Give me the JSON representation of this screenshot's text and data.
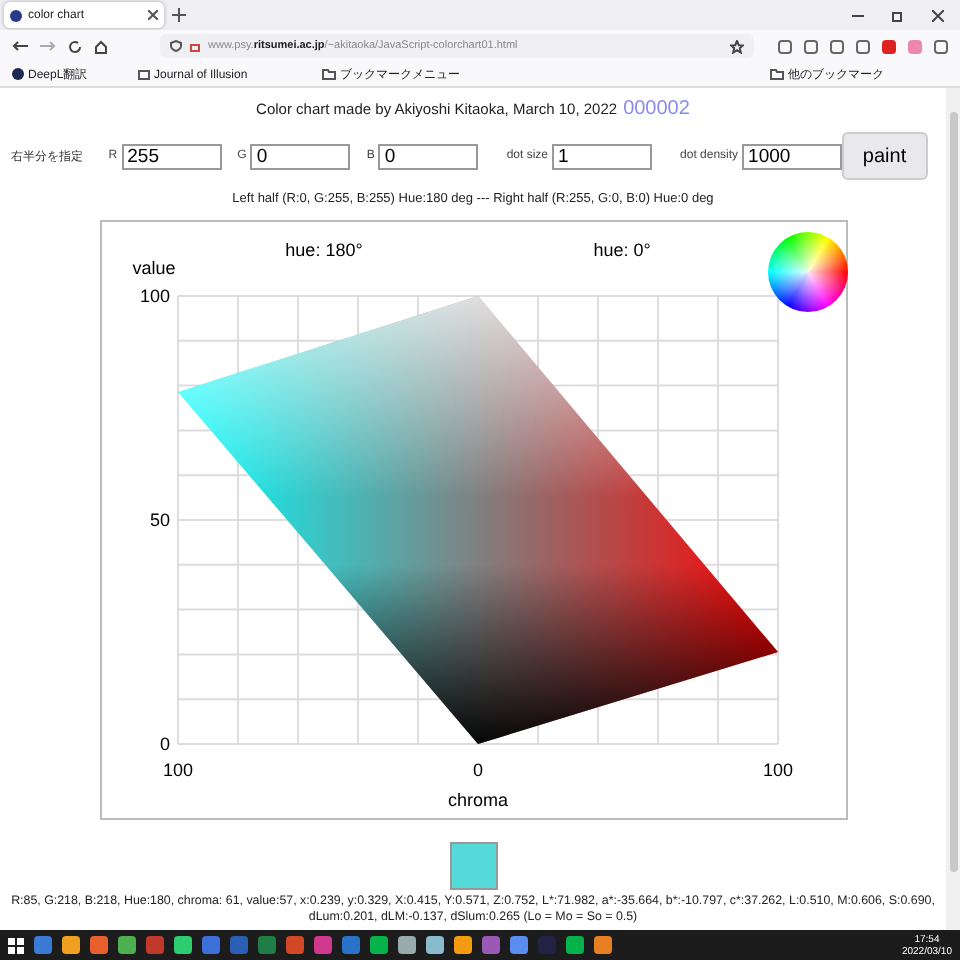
{
  "browser": {
    "tab": {
      "title": "color chart",
      "selected": true
    },
    "url": "www.psy.**ritsumei.ac.jp**/~akitaoka/JavaScript-colorchart01.html",
    "bookmarks": [
      {
        "kind": "site",
        "label": "DeepL翻訳"
      },
      {
        "kind": "pdf",
        "label": "Journal of Illusion"
      },
      {
        "kind": "folder",
        "label": "ブックマークメニュー"
      }
    ],
    "other_bookmarks": "他のブックマーク"
  },
  "page": {
    "title": "Color chart made by Akiyoshi Kitaoka, March 10, 2022",
    "counter": "000002",
    "controls": {
      "label": "右半分を指定",
      "fields": [
        {
          "label": "R",
          "value": "255"
        },
        {
          "label": "G",
          "value": "0"
        },
        {
          "label": "B",
          "value": "0"
        },
        {
          "label": "dot size",
          "value": "1"
        },
        {
          "label": "dot density",
          "value": "1000"
        }
      ],
      "button": "paint"
    },
    "legend": "Left half (R:0, G:255, B:255) Hue:180 deg --- Right half (R:255, G:0, B:0) Hue:0 deg",
    "chart": {
      "hue_left": "hue: 180°",
      "hue_right": "hue: 0°",
      "ylabel": "value",
      "yticks": [
        "100",
        "50",
        "0"
      ],
      "xticks": [
        "100",
        "0",
        "100"
      ],
      "xlabel": "chroma"
    },
    "swatch": {
      "color": "#55dada"
    },
    "readout": "R:85, G:218, B:218, Hue:180, chroma: 61, value:57, x:0.239, y:0.329, X:0.415, Y:0.571, Z:0.752, L*:71.982, a*:-35.664, b*:-10.797, c*:37.262, L:0.510, M:0.606, S:0.690, dLum:0.201, dLM:-0.137, dSlum:0.265 (Lo = Mo = So = 0.5)"
  },
  "taskbar": {
    "time": "17:54",
    "date": "2022/03/10"
  }
}
